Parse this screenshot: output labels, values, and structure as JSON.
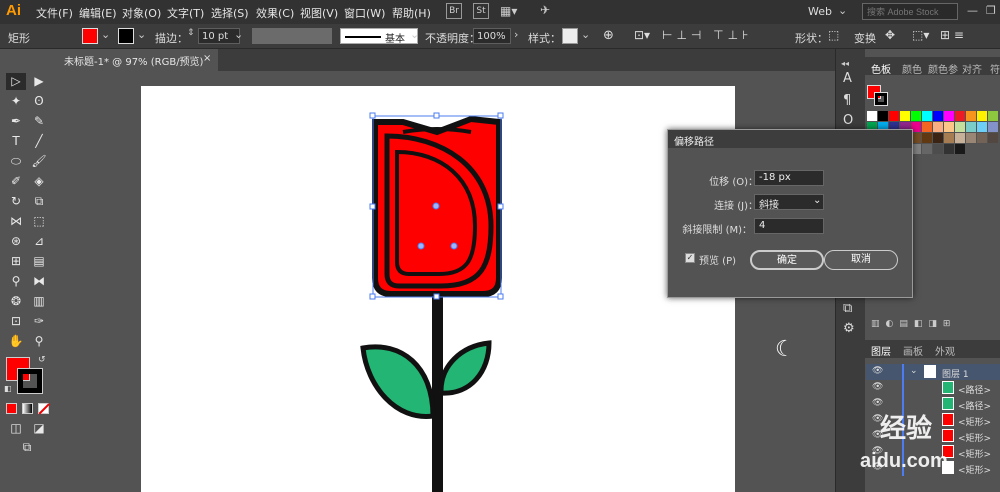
{
  "app": {
    "logo": "Ai"
  },
  "menu": [
    "文件(F)",
    "编辑(E)",
    "对象(O)",
    "文字(T)",
    "选择(S)",
    "效果(C)",
    "视图(V)",
    "窗口(W)",
    "帮助(H)"
  ],
  "bridge": [
    "Br",
    "St"
  ],
  "workspace": "Web",
  "search_placeholder": "搜索 Adobe Stock",
  "control": {
    "selection_type": "矩形",
    "stroke_label": "描边：",
    "stroke_value": "10 pt",
    "brush_label": "基本",
    "opacity_label": "不透明度：",
    "opacity_value": "100%",
    "style_label": "样式：",
    "shape_label": "形状：",
    "transform_label": "变换",
    "fill_color": "#ff0000"
  },
  "document_tab": {
    "title": "未标题-1* @ 97% (RGB/预览)",
    "close": "×"
  },
  "panel_tabs": [
    "色板",
    "颜色",
    "颜色参",
    "对齐",
    "符"
  ],
  "layers_tabs": [
    "图层",
    "画板",
    "外观"
  ],
  "layers": [
    {
      "name": "图层 1"
    },
    {
      "name": "<路径>"
    },
    {
      "name": "<路径>"
    },
    {
      "name": "<矩形>"
    },
    {
      "name": "<矩形>"
    },
    {
      "name": "<矩形>"
    },
    {
      "name": "<矩形>"
    }
  ],
  "dialog": {
    "title": "偏移路径",
    "offset_label": "位移 (O)：",
    "offset_value": "-18 px",
    "join_label": "连接 (J)：",
    "join_value": "斜接",
    "miter_label": "斜接限制 (M)：",
    "miter_value": "4",
    "preview_label": "预览 (P)",
    "ok": "确定",
    "cancel": "取消"
  },
  "colors": {
    "fill": "#ff0000",
    "leaf": "#22b573",
    "outline": "#111111"
  },
  "watermark": {
    "line1": "经验",
    "line2": "aidu.com"
  }
}
